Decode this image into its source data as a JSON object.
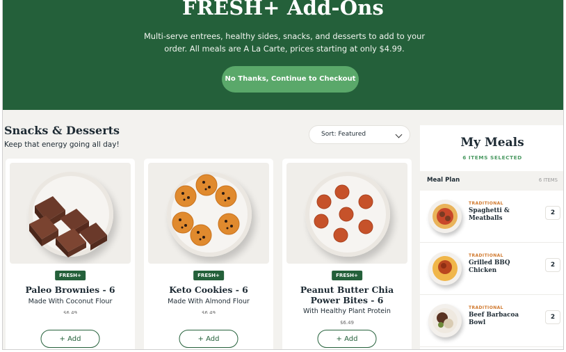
{
  "hero": {
    "title": "FRESH+ Add-Ons",
    "description": "Multi-serve entrees, healthy sides, snacks, and desserts to add to your order. All meals are A La Carte, prices starting at only $4.99.",
    "cta": "No Thanks, Continue to Checkout"
  },
  "section": {
    "title": "Snacks & Desserts",
    "subtitle": "Keep that energy going all day!",
    "sort_label": "Sort: Featured"
  },
  "products": [
    {
      "badge": "FRESH+",
      "name": "Paleo Brownies - 6",
      "subtitle": "Made With Coconut Flour",
      "price": "$6.49",
      "add_label": "+ Add"
    },
    {
      "badge": "FRESH+",
      "name": "Keto Cookies - 6",
      "subtitle": "Made With Almond Flour",
      "price": "$6.49",
      "add_label": "+ Add"
    },
    {
      "badge": "FRESH+",
      "name": "Peanut Butter Chia Power Bites - 6",
      "subtitle": "With Healthy Plant Protein",
      "price": "$6.49",
      "add_label": "+ Add"
    }
  ],
  "panel": {
    "title": "My Meals",
    "count": "6 ITEMS SELECTED",
    "plan_label": "Meal Plan",
    "plan_items": "6 ITEMS",
    "meals": [
      {
        "tag": "TRADITIONAL",
        "name": "Spaghetti & Meatballs",
        "qty": "2"
      },
      {
        "tag": "TRADITIONAL",
        "name": "Grilled BBQ Chicken",
        "qty": "2"
      },
      {
        "tag": "TRADITIONAL",
        "name": "Beef Barbacoa Bowl",
        "qty": "2"
      }
    ]
  },
  "colors": {
    "brand_green": "#24603a",
    "button_green": "#5aa86a",
    "accent_orange": "#d0782c"
  }
}
